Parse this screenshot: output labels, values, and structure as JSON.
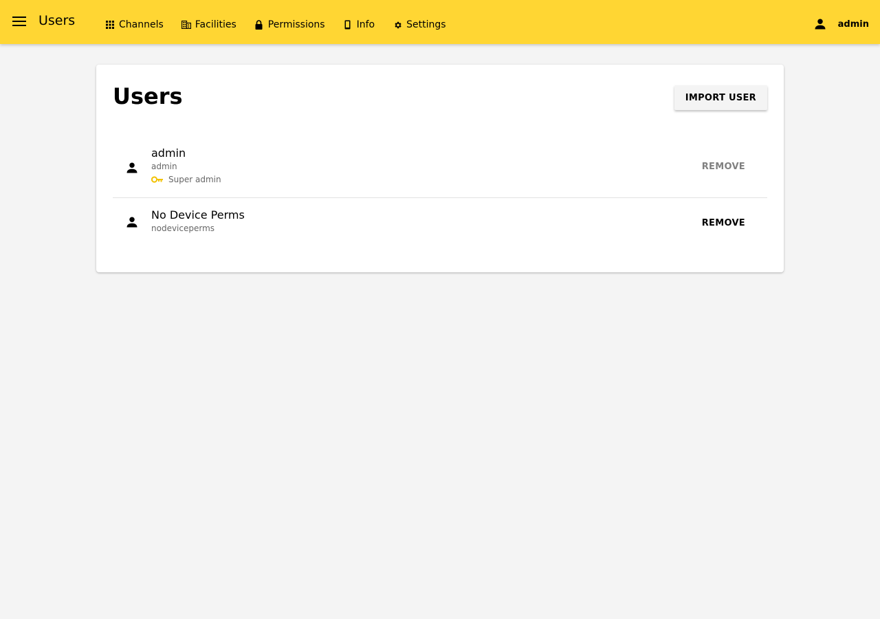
{
  "appbar": {
    "title": "Users",
    "menu_icon": "menu-icon",
    "nav": [
      {
        "label": "Channels",
        "icon": "apps-grid-icon"
      },
      {
        "label": "Facilities",
        "icon": "building-icon"
      },
      {
        "label": "Permissions",
        "icon": "lock-icon"
      },
      {
        "label": "Info",
        "icon": "phone-icon"
      },
      {
        "label": "Settings",
        "icon": "gear-icon"
      }
    ],
    "account": {
      "label": "admin",
      "icon": "person-icon"
    },
    "color": "#ffd633"
  },
  "card": {
    "title": "Users",
    "import_label": "IMPORT USER"
  },
  "users": [
    {
      "name": "admin",
      "login": "admin",
      "role": "Super admin",
      "role_icon": "key-icon",
      "remove_label": "REMOVE",
      "remove_disabled": true
    },
    {
      "name": "No Device Perms",
      "login": "nodeviceperms",
      "remove_label": "REMOVE",
      "remove_disabled": false
    }
  ],
  "colors": {
    "accent": "#ffd633",
    "key_icon": "#f2c200",
    "background": "#f4f4f4"
  }
}
